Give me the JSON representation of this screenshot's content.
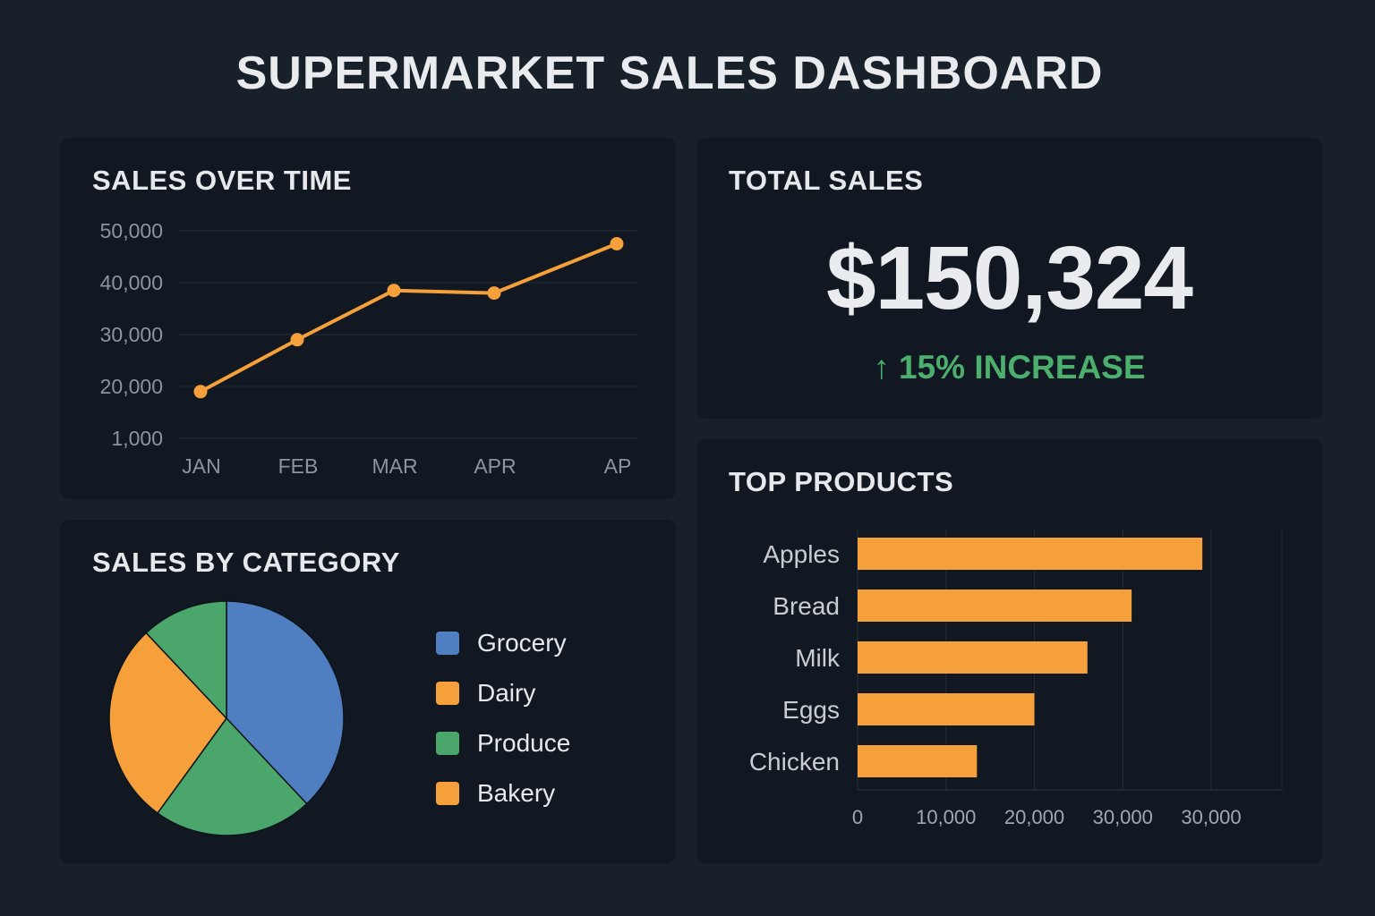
{
  "title": "SUPERMARKET SALES DASHBOARD",
  "colors": {
    "accent": "#f5a03a",
    "increase": "#4caf6e",
    "grocery": "#4f7fc1",
    "dairy": "#f5a03a",
    "produce": "#4aa66a",
    "bakery": "#f5a03a"
  },
  "total_sales": {
    "title": "TOTAL SALES",
    "value": "$150,324",
    "change_icon": "arrow-up-icon",
    "change": "15% INCREASE"
  },
  "chart_data": [
    {
      "type": "line",
      "title": "SALES OVER TIME",
      "categories": [
        "JAN",
        "FEB",
        "MAR",
        "APR",
        "AP"
      ],
      "y_tick_labels": [
        "50,000",
        "40,000",
        "30,000",
        "20,000",
        "1,000"
      ],
      "values": [
        19000,
        29000,
        38500,
        38000,
        47500
      ],
      "ylim": [
        10000,
        50000
      ],
      "grid": true,
      "xlabel": "",
      "ylabel": ""
    },
    {
      "type": "pie",
      "title": "SALES BY CATEGORY",
      "labels": [
        "Grocery",
        "Produce",
        "Dairy",
        "Produce"
      ],
      "values": [
        38,
        22,
        28,
        12
      ],
      "slice_colors": [
        "#4f7fc1",
        "#4aa66a",
        "#f5a03a",
        "#4aa66a"
      ],
      "legend": [
        {
          "label": "Grocery",
          "color": "#4f7fc1"
        },
        {
          "label": "Dairy",
          "color": "#f5a03a"
        },
        {
          "label": "Produce",
          "color": "#4aa66a"
        },
        {
          "label": "Bakery",
          "color": "#f5a03a"
        }
      ],
      "legend_position": "right"
    },
    {
      "type": "bar",
      "orientation": "horizontal",
      "title": "TOP PRODUCTS",
      "categories": [
        "Apples",
        "Bread",
        "Milk",
        "Eggs",
        "Chicken"
      ],
      "values": [
        39000,
        31000,
        26000,
        20000,
        13500
      ],
      "x_tick_values": [
        0,
        10000,
        20000,
        30000,
        40000
      ],
      "x_tick_labels": [
        "0",
        "10,000",
        "20,000",
        "30,000",
        "30,000"
      ],
      "xlim": [
        0,
        48000
      ],
      "grid": true,
      "xlabel": "",
      "ylabel": ""
    }
  ]
}
